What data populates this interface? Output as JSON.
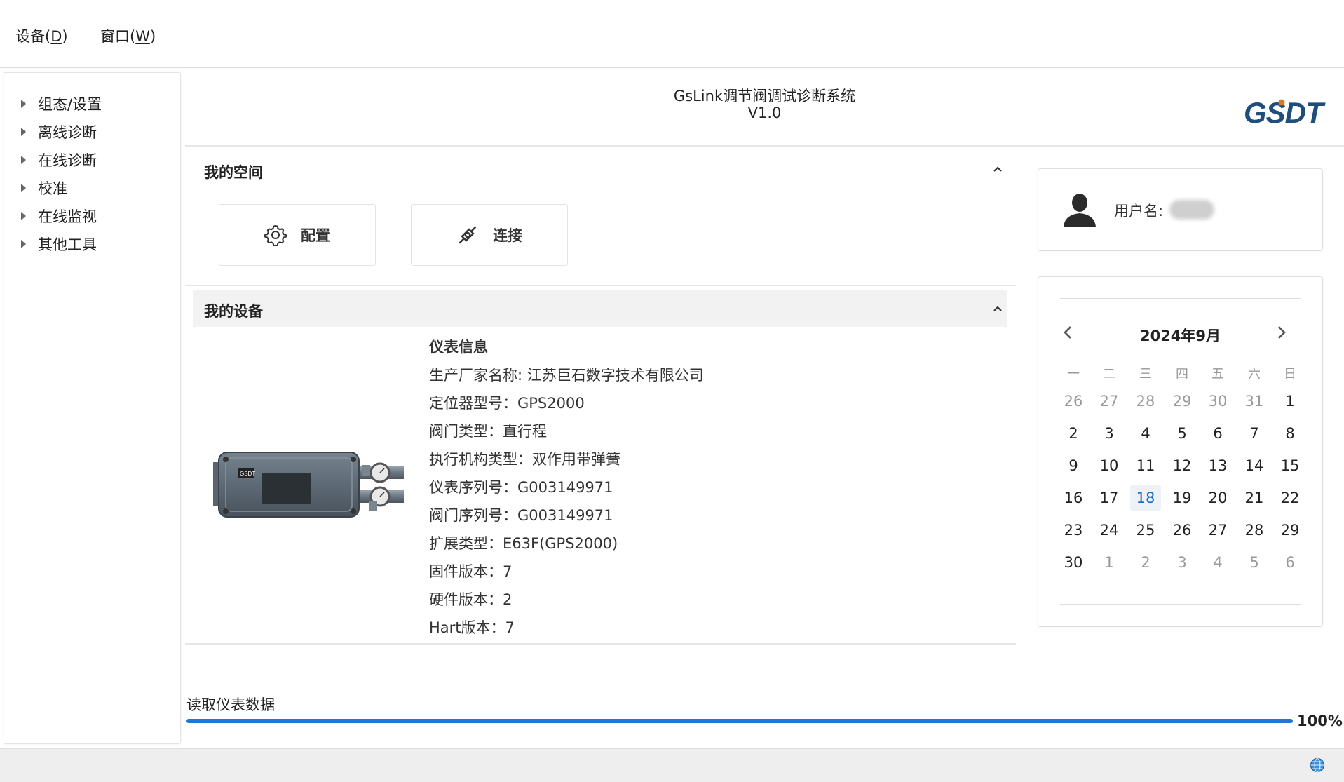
{
  "menubar": {
    "items": [
      {
        "label": "设备(",
        "mnemonic": "D",
        "close": ")"
      },
      {
        "label": "窗口(",
        "mnemonic": "W",
        "close": ")"
      }
    ]
  },
  "sidebar": {
    "items": [
      {
        "label": "组态/设置"
      },
      {
        "label": "离线诊断"
      },
      {
        "label": "在线诊断"
      },
      {
        "label": "校准"
      },
      {
        "label": "在线监视"
      },
      {
        "label": "其他工具"
      }
    ]
  },
  "header": {
    "title": "GsLink调节阀调试诊断系统",
    "version": "V1.0",
    "logo_text": "GSDT",
    "logo_color": "#1f4e7a",
    "logo_accent": "#e8741c"
  },
  "space": {
    "title": "我的空间",
    "config_label": "配置",
    "connect_label": "连接"
  },
  "device": {
    "title": "我的设备",
    "info_title": "仪表信息",
    "manufacturer": "生产厂家名称: 江苏巨石数字技术有限公司",
    "positioner_model": "定位器型号：GPS2000",
    "valve_type": "阀门类型：直行程",
    "actuator_type": "执行机构类型：双作用带弹簧",
    "instrument_serial": "仪表序列号：G003149971",
    "valve_serial": "阀门序列号：G003149971",
    "extension_type": "扩展类型：E63F(GPS2000)",
    "firmware_version": "固件版本：7",
    "hardware_version": "硬件版本：2",
    "hart_version": "Hart版本：7"
  },
  "user": {
    "label": "用户名:"
  },
  "calendar": {
    "title": "2024年9月",
    "weekdays": [
      "一",
      "二",
      "三",
      "四",
      "五",
      "六",
      "日"
    ],
    "weeks": [
      [
        "26",
        "27",
        "28",
        "29",
        "30",
        "31",
        "1"
      ],
      [
        "2",
        "3",
        "4",
        "5",
        "6",
        "7",
        "8"
      ],
      [
        "9",
        "10",
        "11",
        "12",
        "13",
        "14",
        "15"
      ],
      [
        "16",
        "17",
        "18",
        "19",
        "20",
        "21",
        "22"
      ],
      [
        "23",
        "24",
        "25",
        "26",
        "27",
        "28",
        "29"
      ],
      [
        "30",
        "1",
        "2",
        "3",
        "4",
        "5",
        "6"
      ]
    ],
    "today": "18",
    "today_color": "#1b6fc2"
  },
  "progress": {
    "label": "读取仪表数据",
    "percent_text": "100%",
    "value": 1.0,
    "color": "#1f78d1"
  },
  "statusbar": {
    "icon": "globe-icon"
  }
}
